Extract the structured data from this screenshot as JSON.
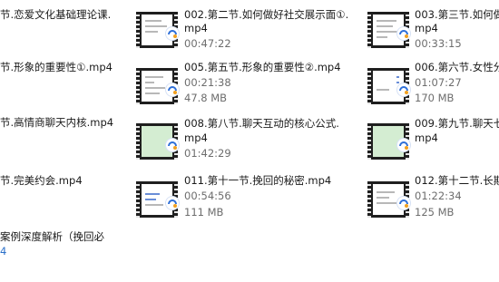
{
  "files": [
    {
      "id": "f001",
      "name": [
        "节.恋爱文化基础理论课."
      ],
      "duration": "",
      "size": ""
    },
    {
      "id": "f002",
      "name": [
        "002.第二节.如何做好社交展示面①.",
        "mp4"
      ],
      "duration": "00:47:22",
      "size": ""
    },
    {
      "id": "f003",
      "name": [
        "003.第三节.如何做",
        "mp4"
      ],
      "duration": "00:33:15",
      "size": ""
    },
    {
      "id": "f004",
      "name": [
        "节.形象的重要性①.mp4"
      ],
      "duration": "",
      "size": ""
    },
    {
      "id": "f005",
      "name": [
        "005.第五节.形象的重要性②.mp4"
      ],
      "duration": "00:21:38",
      "size": "47.8 MB"
    },
    {
      "id": "f006",
      "name": [
        "006.第六节.女性分"
      ],
      "duration": "01:07:27",
      "size": "170 MB"
    },
    {
      "id": "f007",
      "name": [
        "节.高情商聊天内核.mp4"
      ],
      "duration": "",
      "size": ""
    },
    {
      "id": "f008",
      "name": [
        "008.第八节.聊天互动的核心公式.",
        "mp4"
      ],
      "duration": "01:42:29",
      "size": ""
    },
    {
      "id": "f009",
      "name": [
        "009.第九节.聊天七",
        "mp4"
      ],
      "duration": "",
      "size": ""
    },
    {
      "id": "f010",
      "name": [
        "节.完美约会.mp4"
      ],
      "duration": "",
      "size": ""
    },
    {
      "id": "f011",
      "name": [
        "011.第十一节.挽回的秘密.mp4"
      ],
      "duration": "00:54:56",
      "size": "111 MB"
    },
    {
      "id": "f012",
      "name": [
        "012.第十二节.长期"
      ],
      "duration": "01:22:34",
      "size": "125 MB"
    }
  ],
  "extra_item": {
    "name": "案例深度解析（挽回必",
    "suffix": "4"
  },
  "colors": {
    "text": "#1a1a1a",
    "meta": "#6d6d6d",
    "link": "#2a6fc9",
    "film": "#1f1f1f",
    "green_screen": "#d4edd2"
  },
  "icons": {
    "video": "video-file-icon",
    "play": "play-badge-icon"
  }
}
